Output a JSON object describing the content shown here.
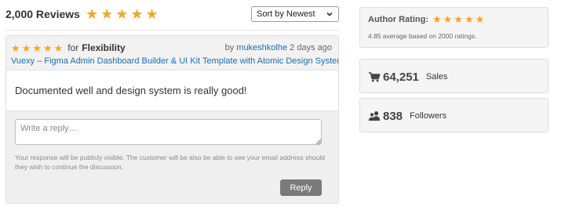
{
  "reviews": {
    "count_label": "2,000 Reviews",
    "stars": 5,
    "sort": {
      "selected": "Sort by Newest"
    }
  },
  "review": {
    "rating": 5,
    "for_label": "for",
    "category": "Flexibility",
    "by_label": "by",
    "author": "mukeshkolhe",
    "time": "2 days ago",
    "item_title": "Vuexy – Figma Admin Dashboard Builder & UI Kit Template with Atomic Design System",
    "text": "Documented well and design system is really good!",
    "reply": {
      "placeholder": "Write a reply…",
      "notice": "Your response will be publicly visible. The customer will be also be able to see your email address should they wish to continue the discussion.",
      "button_label": "Reply"
    }
  },
  "sidebar": {
    "author_rating": {
      "title": "Author Rating:",
      "stars": 5,
      "average": "4.85 average based on 2000 ratings."
    },
    "sales": {
      "icon": "cart-icon",
      "value": "64,251",
      "label": "Sales"
    },
    "followers": {
      "icon": "users-icon",
      "value": "838",
      "label": "Followers"
    }
  },
  "colors": {
    "star": "#f5a623",
    "link": "#1a6fb5",
    "reply_button": "#7a7a7a",
    "panel_bg": "#f5f5f5"
  }
}
